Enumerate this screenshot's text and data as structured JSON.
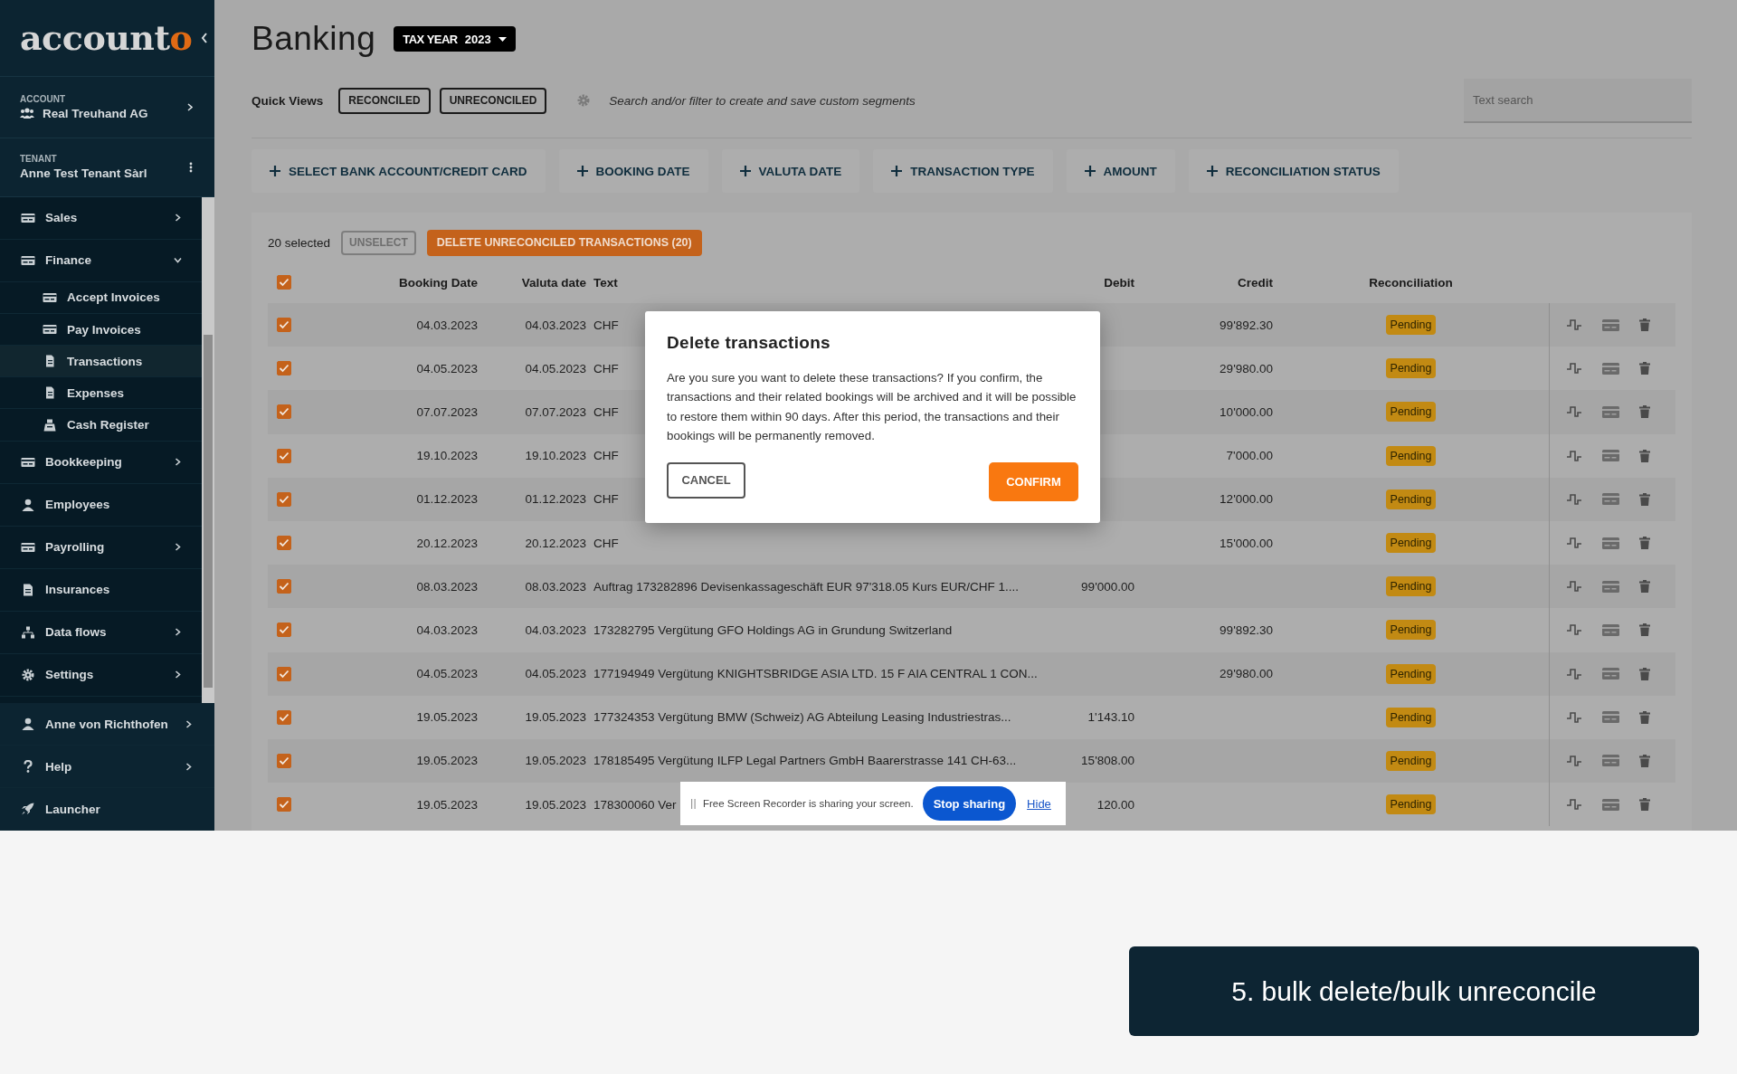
{
  "sidebar": {
    "logo": {
      "text": "account",
      "accent": "o"
    },
    "account": {
      "label": "ACCOUNT",
      "name": "Real Treuhand AG"
    },
    "tenant": {
      "label": "TENANT",
      "name": "Anne Test Tenant Sàrl"
    },
    "nav": [
      {
        "label": "Sales",
        "kind": "card",
        "expandable": true,
        "expanded": false
      },
      {
        "label": "Finance",
        "kind": "card",
        "expandable": true,
        "expanded": true,
        "children": [
          {
            "label": "Accept Invoices",
            "kind": "card",
            "selected": false
          },
          {
            "label": "Pay Invoices",
            "kind": "card",
            "selected": false
          },
          {
            "label": "Transactions",
            "kind": "doc",
            "selected": true
          },
          {
            "label": "Expenses",
            "kind": "doc",
            "selected": false
          },
          {
            "label": "Cash Register",
            "kind": "register",
            "selected": false
          }
        ]
      },
      {
        "label": "Bookkeeping",
        "kind": "card",
        "expandable": true,
        "expanded": false
      },
      {
        "label": "Employees",
        "kind": "person",
        "expandable": false
      },
      {
        "label": "Payrolling",
        "kind": "card",
        "expandable": true,
        "expanded": false
      },
      {
        "label": "Insurances",
        "kind": "doc",
        "expandable": false
      },
      {
        "label": "Data flows",
        "kind": "network",
        "expandable": true,
        "expanded": false
      },
      {
        "label": "Settings",
        "kind": "gear",
        "expandable": true,
        "expanded": false
      }
    ],
    "footer": [
      {
        "label": "Anne von Richthofen",
        "kind": "person",
        "expandable": true
      },
      {
        "label": "Help",
        "kind": "help",
        "expandable": true
      },
      {
        "label": "Launcher",
        "kind": "rocket",
        "expandable": false
      }
    ]
  },
  "page": {
    "title": "Banking",
    "tax_year": {
      "label": "TAX YEAR",
      "value": "2023"
    }
  },
  "quick_views": {
    "label": "Quick Views",
    "options": [
      "RECONCILED",
      "UNRECONCILED"
    ],
    "hint": "Search and/or filter to create and save custom segments",
    "search": {
      "placeholder": "Text search"
    }
  },
  "filters": [
    "SELECT BANK ACCOUNT/CREDIT CARD",
    "BOOKING DATE",
    "VALUTA DATE",
    "TRANSACTION TYPE",
    "AMOUNT",
    "RECONCILIATION STATUS"
  ],
  "selection": {
    "count": "20 selected",
    "unselect": "UNSELECT",
    "delete": "DELETE UNRECONCILED TRANSACTIONS (20)",
    "all_checked": true
  },
  "table": {
    "columns": [
      "Booking Date",
      "Valuta date",
      "Text",
      "Debit",
      "Credit",
      "Reconciliation"
    ],
    "rows": [
      {
        "checked": true,
        "booking": "04.03.2023",
        "valuta": "04.03.2023",
        "text": "CHF",
        "debit": "",
        "credit": "99'892.30",
        "status": "Pending"
      },
      {
        "checked": true,
        "booking": "04.05.2023",
        "valuta": "04.05.2023",
        "text": "CHF",
        "debit": "",
        "credit": "29'980.00",
        "status": "Pending"
      },
      {
        "checked": true,
        "booking": "07.07.2023",
        "valuta": "07.07.2023",
        "text": "CHF",
        "debit": "",
        "credit": "10'000.00",
        "status": "Pending"
      },
      {
        "checked": true,
        "booking": "19.10.2023",
        "valuta": "19.10.2023",
        "text": "CHF",
        "debit": "",
        "credit": "7'000.00",
        "status": "Pending"
      },
      {
        "checked": true,
        "booking": "01.12.2023",
        "valuta": "01.12.2023",
        "text": "CHF",
        "debit": "",
        "credit": "12'000.00",
        "status": "Pending"
      },
      {
        "checked": true,
        "booking": "20.12.2023",
        "valuta": "20.12.2023",
        "text": "CHF",
        "debit": "",
        "credit": "15'000.00",
        "status": "Pending"
      },
      {
        "checked": true,
        "booking": "08.03.2023",
        "valuta": "08.03.2023",
        "text": "Auftrag 173282896 Devisenkassageschäft EUR 97'318.05 Kurs EUR/CHF 1....",
        "debit": "99'000.00",
        "credit": "",
        "status": "Pending"
      },
      {
        "checked": true,
        "booking": "04.03.2023",
        "valuta": "04.03.2023",
        "text": "173282795 Vergütung GFO Holdings AG in Grundung Switzerland",
        "debit": "",
        "credit": "99'892.30",
        "status": "Pending"
      },
      {
        "checked": true,
        "booking": "04.05.2023",
        "valuta": "04.05.2023",
        "text": "177194949 Vergütung KNIGHTSBRIDGE ASIA LTD. 15 F AIA CENTRAL 1 CON...",
        "debit": "",
        "credit": "29'980.00",
        "status": "Pending"
      },
      {
        "checked": true,
        "booking": "19.05.2023",
        "valuta": "19.05.2023",
        "text": "177324353 Vergütung BMW (Schweiz) AG Abteilung Leasing Industriestras...",
        "debit": "1'143.10",
        "credit": "",
        "status": "Pending"
      },
      {
        "checked": true,
        "booking": "19.05.2023",
        "valuta": "19.05.2023",
        "text": "178185495 Vergütung ILFP Legal Partners GmbH Baarerstrasse 141 CH-63...",
        "debit": "15'808.00",
        "credit": "",
        "status": "Pending"
      },
      {
        "checked": true,
        "booking": "19.05.2023",
        "valuta": "19.05.2023",
        "text": "178300060 Ver",
        "debit": "120.00",
        "credit": "",
        "status": "Pending"
      }
    ]
  },
  "dialog": {
    "title": "Delete transactions",
    "body": "Are you sure you want to delete these transactions? If you confirm, the transactions and their related bookings will be archived and it will be possible to restore them within 90 days. After this period, the transactions and their bookings will be permanently removed.",
    "cancel": "CANCEL",
    "confirm": "CONFIRM"
  },
  "share_bar": {
    "message": "Free Screen Recorder is sharing your screen.",
    "stop": "Stop sharing",
    "hide": "Hide"
  },
  "caption": "5. bulk delete/bulk unreconcile"
}
